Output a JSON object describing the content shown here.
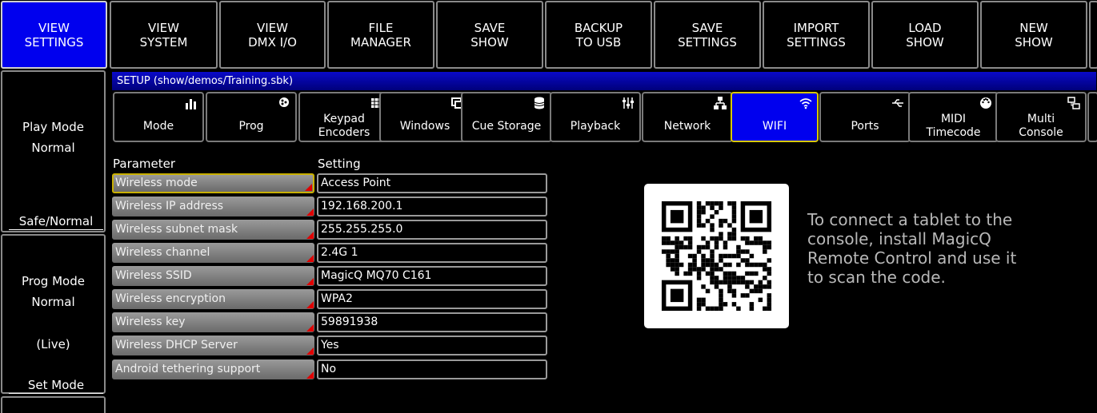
{
  "toolbar": {
    "buttons": [
      {
        "label": "VIEW\nSETTINGS"
      },
      {
        "label": "VIEW\nSYSTEM"
      },
      {
        "label": "VIEW\nDMX I/O"
      },
      {
        "label": "FILE\nMANAGER"
      },
      {
        "label": "SAVE\nSHOW"
      },
      {
        "label": "BACKUP\nTO USB"
      },
      {
        "label": "SAVE\nSETTINGS"
      },
      {
        "label": "IMPORT\nSETTINGS"
      },
      {
        "label": "LOAD\nSHOW"
      },
      {
        "label": "NEW\nSHOW"
      }
    ]
  },
  "left": {
    "play_mode_label": "Play Mode",
    "play_mode_value": "Normal",
    "safe_normal": "Safe/Normal",
    "prog_mode_label": "Prog Mode",
    "prog_mode_value": "Normal",
    "live": "(Live)",
    "set_mode": "Set Mode"
  },
  "setup": {
    "title": "SETUP (show/demos/Training.sbk)",
    "tabs": [
      {
        "label": "Mode",
        "icon": "mode-icon"
      },
      {
        "label": "Prog",
        "icon": "prog-icon"
      },
      {
        "label": "Keypad\nEncoders",
        "icon": "keypad-icon"
      },
      {
        "label": "Windows",
        "icon": "windows-icon"
      },
      {
        "label": "Cue Storage",
        "icon": "database-icon"
      },
      {
        "label": "Playback",
        "icon": "faders-icon"
      },
      {
        "label": "Network",
        "icon": "network-icon"
      },
      {
        "label": "WIFI",
        "icon": "wifi-icon"
      },
      {
        "label": "Ports",
        "icon": "usb-icon"
      },
      {
        "label": "MIDI\nTimecode",
        "icon": "midi-icon"
      },
      {
        "label": "Multi\nConsole",
        "icon": "multi-console-icon"
      }
    ],
    "column_parameter": "Parameter",
    "column_setting": "Setting",
    "rows": [
      {
        "name": "Wireless mode",
        "value": "Access Point"
      },
      {
        "name": "Wireless IP address",
        "value": "192.168.200.1"
      },
      {
        "name": "Wireless subnet mask",
        "value": "255.255.255.0"
      },
      {
        "name": "Wireless channel",
        "value": "2.4G 1"
      },
      {
        "name": "Wireless SSID",
        "value": "MagicQ MQ70 C161"
      },
      {
        "name": "Wireless encryption",
        "value": "WPA2"
      },
      {
        "name": "Wireless key",
        "value": "59891938"
      },
      {
        "name": "Wireless DHCP Server",
        "value": "Yes"
      },
      {
        "name": "Android tethering support",
        "value": "No"
      }
    ],
    "qr_text": "To connect a tablet to the\nconsole, install MagicQ\nRemote Control and use it\nto scan the code."
  },
  "colors": {
    "active_blue": "#0000ee",
    "selection_yellow": "#c9b000",
    "marker_red": "#e00000"
  }
}
